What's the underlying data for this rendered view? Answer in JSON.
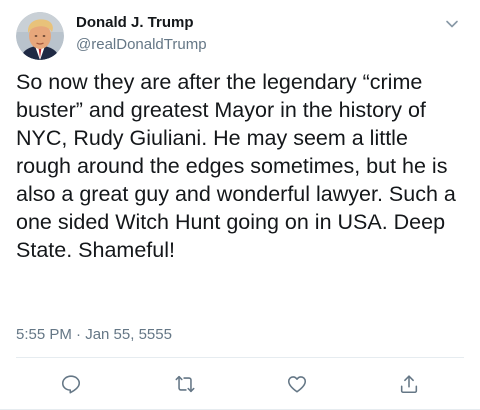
{
  "tweet": {
    "author": {
      "name": "Donald J. Trump",
      "handle": "@realDonaldTrump",
      "avatar_icon": "profile-photo"
    },
    "text": "So now they are after the legendary “crime buster” and greatest Mayor in the history of NYC, Rudy Giuliani. He may seem a little rough around the edges sometimes, but he is also a great guy and wonderful lawyer. Such a one sided Witch Hunt going on in USA. Deep State. Shameful!",
    "timestamp": "5:55 PM · Jan 55, 5555",
    "actions": [
      {
        "icon": "reply-icon"
      },
      {
        "icon": "retweet-icon"
      },
      {
        "icon": "like-icon"
      },
      {
        "icon": "share-icon"
      }
    ],
    "menu_icon": "chevron-down-icon"
  },
  "colors": {
    "text_primary": "#14171a",
    "text_secondary": "#657786",
    "divider": "#e6ecf0"
  }
}
